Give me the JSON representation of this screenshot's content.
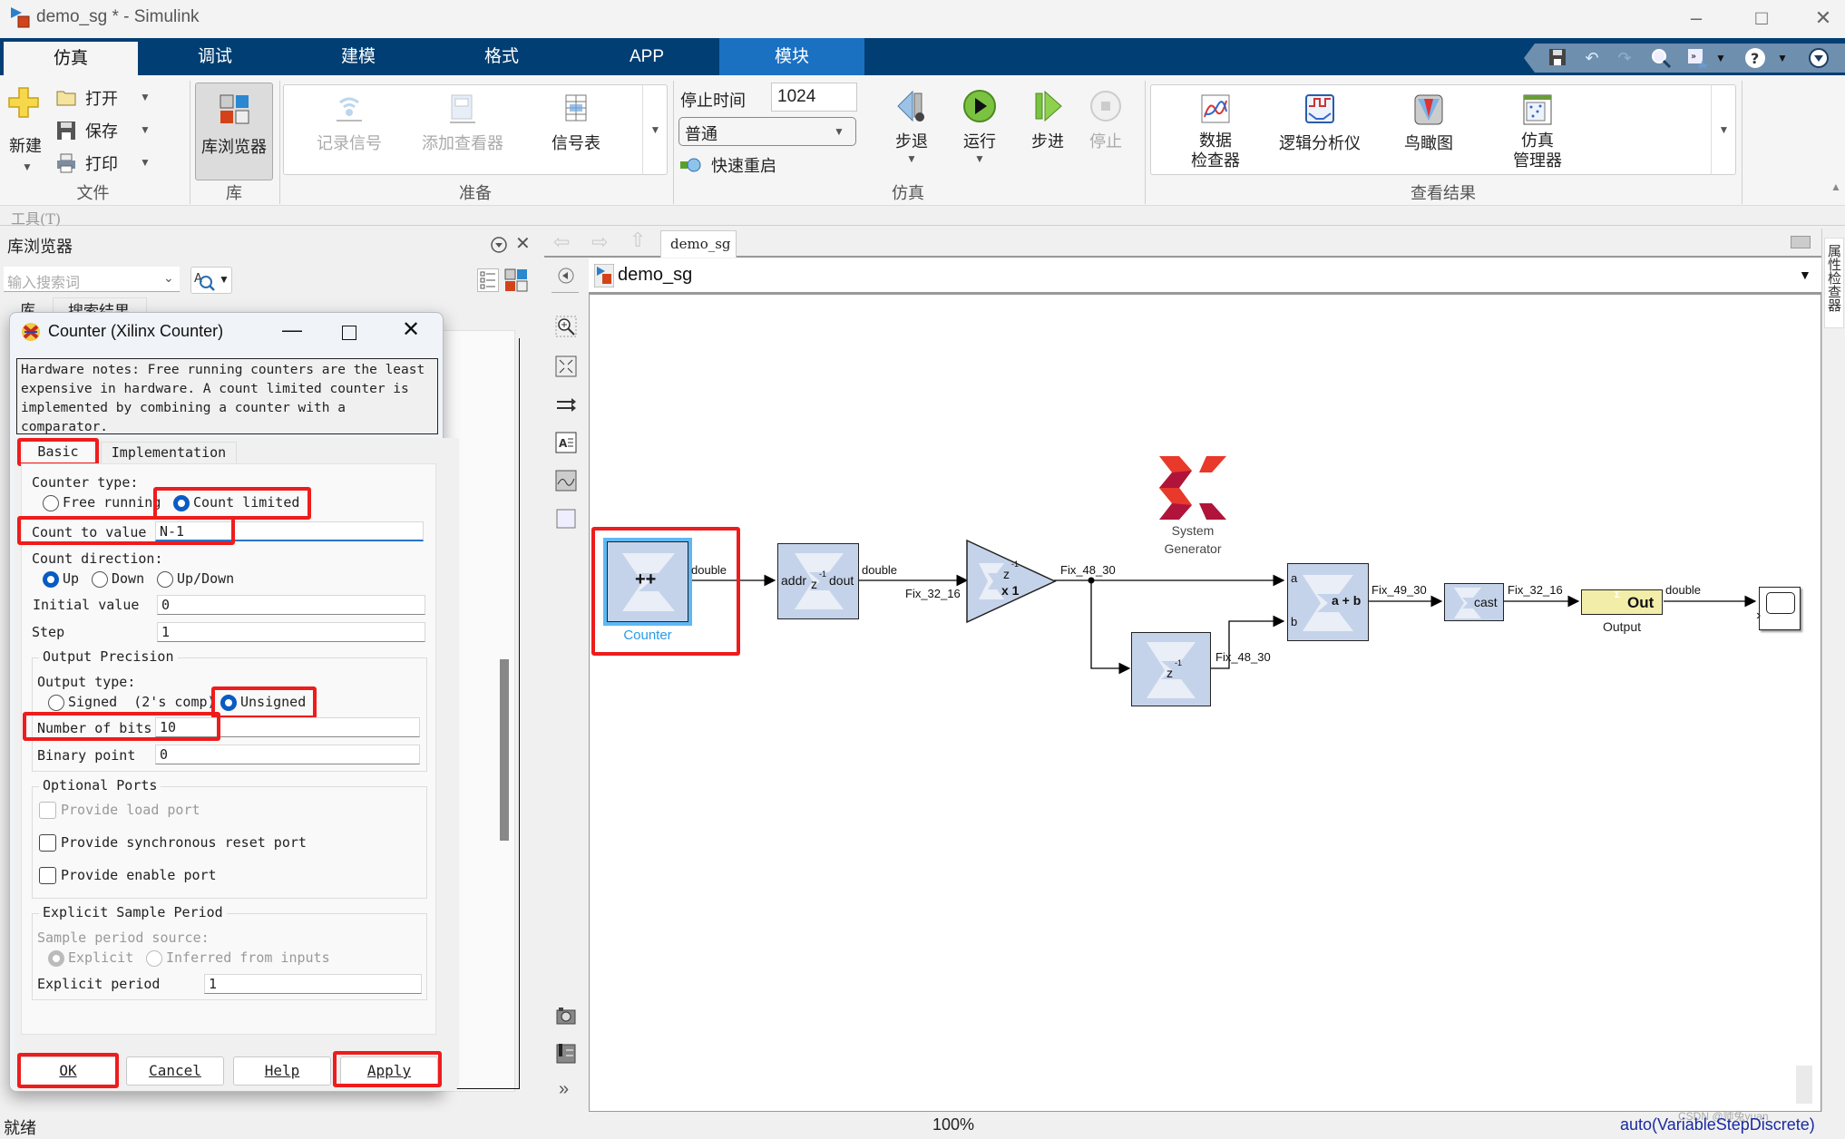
{
  "window": {
    "title": "demo_sg * - Simulink",
    "minimize": "–",
    "maximize": "□",
    "close": "✕"
  },
  "ribbon": {
    "tabs": [
      {
        "label": "仿真",
        "active": true
      },
      {
        "label": "调试"
      },
      {
        "label": "建模"
      },
      {
        "label": "格式"
      },
      {
        "label": "APP"
      },
      {
        "label": "模块",
        "contextual": true
      }
    ],
    "file_group": {
      "label": "文件",
      "new_label": "新建",
      "open_label": "打开",
      "save_label": "保存",
      "print_label": "打印"
    },
    "library_group": {
      "label": "库",
      "library_browser_label": "库浏览器"
    },
    "prepare_group": {
      "label": "准备",
      "log_signals_label": "记录信号",
      "add_viewer_label": "添加查看器",
      "signal_table_label": "信号表"
    },
    "simulate_group": {
      "label": "仿真",
      "stop_time_label": "停止时间",
      "stop_time_value": "1024",
      "mode_value": "普通",
      "fast_restart_label": "快速重启",
      "step_back_label": "步退",
      "run_label": "运行",
      "step_forward_label": "步进",
      "stop_label": "停止"
    },
    "review_group": {
      "label": "查看结果",
      "data_inspector_label1": "数据",
      "data_inspector_label2": "检查器",
      "logic_analyzer_label": "逻辑分析仪",
      "birds_eye_label": "鸟瞰图",
      "sim_manager_label1": "仿真",
      "sim_manager_label2": "管理器"
    }
  },
  "tools_menu": "工具(T)",
  "library_browser": {
    "title": "库浏览器",
    "search_placeholder": "输入搜索词",
    "tabs": [
      "库",
      "搜索结果"
    ]
  },
  "dialog": {
    "title": "Counter (Xilinx Counter)",
    "notes": "Hardware notes: Free running counters are the least expensive in hardware. A count limited counter is implemented by combining a counter with a comparator.",
    "tabs": [
      "Basic",
      "Implementation"
    ],
    "counter_type_label": "Counter type:",
    "counter_type_options": [
      "Free running",
      "Count limited"
    ],
    "counter_type_selected": "Count limited",
    "count_to_value_label": "Count to value",
    "count_to_value": "N-1",
    "count_direction_label": "Count direction:",
    "count_direction_options": [
      "Up",
      "Down",
      "Up/Down"
    ],
    "count_direction_selected": "Up",
    "initial_value_label": "Initial value",
    "initial_value": "0",
    "step_label": "Step",
    "step_value": "1",
    "output_precision_title": "Output Precision",
    "output_type_label": "Output type:",
    "output_type_options": [
      "Signed  (2's comp)",
      "Unsigned"
    ],
    "output_type_selected": "Unsigned",
    "number_of_bits_label": "Number of bits",
    "number_of_bits": "10",
    "binary_point_label": "Binary point",
    "binary_point": "0",
    "optional_ports_title": "Optional Ports",
    "optional_ports": [
      {
        "label": "Provide load port",
        "checked": false,
        "disabled": true
      },
      {
        "label": "Provide synchronous reset port",
        "checked": false,
        "disabled": false
      },
      {
        "label": "Provide enable port",
        "checked": false,
        "disabled": false
      }
    ],
    "sample_period_title": "Explicit Sample Period",
    "sample_period_source_label": "Sample period source:",
    "sample_period_source_options": [
      "Explicit",
      "Inferred from inputs"
    ],
    "sample_period_source_selected": "Explicit",
    "explicit_period_label": "Explicit period",
    "explicit_period": "1",
    "buttons": {
      "ok": "OK",
      "cancel": "Cancel",
      "help": "Help",
      "apply": "Apply"
    }
  },
  "editor": {
    "tab_label": "demo_sg",
    "model_path": "demo_sg",
    "blocks": {
      "counter": {
        "label": "Counter",
        "glyph": "++"
      },
      "rom": {
        "in": "addr",
        "delay": "z",
        "delay_exp": "-1",
        "out": "dout"
      },
      "gain": {
        "delay": "z",
        "delay_exp": "-1",
        "gain": "x 1"
      },
      "delay": {
        "delay": "z",
        "delay_exp": "-1"
      },
      "adder": {
        "in_a": "a",
        "in_b": "b",
        "op": "a + b"
      },
      "convert": {
        "op": "cast"
      },
      "gateway_out": {
        "op": "Out",
        "label": "Output"
      },
      "system_generator": {
        "label1": "System",
        "label2": "Generator"
      }
    },
    "signals": {
      "counter_out": "double",
      "rom_out": "double",
      "gain_in": "Fix_32_16",
      "gain_out": "Fix_48_30",
      "delay_out": "Fix_48_30",
      "adder_out": "Fix_49_30",
      "cast_out": "Fix_32_16",
      "gateway_out": "double"
    },
    "property_inspector_tab": "属性检查器"
  },
  "status": {
    "left": "就绪",
    "zoom": "100%",
    "solver": "auto(VariableStepDiscrete)",
    "watermark": "CSDN @师兔yuan"
  },
  "colors": {
    "ribbon_dark": "#003e73",
    "contextual_tab": "#1a71c2",
    "highlight_red": "#ee1c1c",
    "selected_radio": "#0a5bc4",
    "block_fill": "#c5d3ea",
    "gateway_fill": "#f2eeaa",
    "xilinx_red": "#e8392a",
    "xilinx_dark": "#b0143a"
  }
}
